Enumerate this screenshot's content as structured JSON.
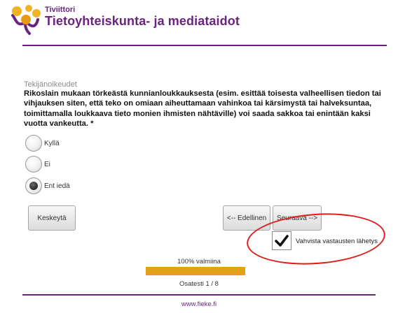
{
  "header": {
    "brand_small": "Tiviittori",
    "brand_title": "Tietoyhteiskunta- ja mediataidot"
  },
  "question": {
    "category": "Tekijänoikeudet",
    "text": "Rikoslain mukaan törkeästä kunnianloukkauksesta (esim. esittää toisesta valheellisen tiedon tai vihjauksen siten, että teko on omiaan aiheuttamaan vahinkoa tai kärsimystä tai halveksuntaa, toimittamalla loukkaava tieto monien ihmisten nähtäville) voi saada sakkoa tai enintään kaksi vuotta vankeutta. *",
    "options": [
      {
        "label": "Kyllä",
        "selected": false
      },
      {
        "label": "Ei",
        "selected": false
      },
      {
        "label": "Ent iedä",
        "selected": true
      }
    ]
  },
  "buttons": {
    "cancel": "Keskeytä",
    "previous": "<-- Edellinen",
    "next": "Seuraava -->"
  },
  "confirm": {
    "label": "Vahvista vastausten lähetys",
    "checked": true
  },
  "progress": {
    "label": "100% valmiina",
    "fraction": 1.0,
    "page": "Osatesti 1 / 8"
  },
  "footer": {
    "link": "www.fieke.fi"
  },
  "colors": {
    "brand": "#6b2380",
    "progress": "#e3a21a",
    "annotation": "#e01c1c"
  }
}
